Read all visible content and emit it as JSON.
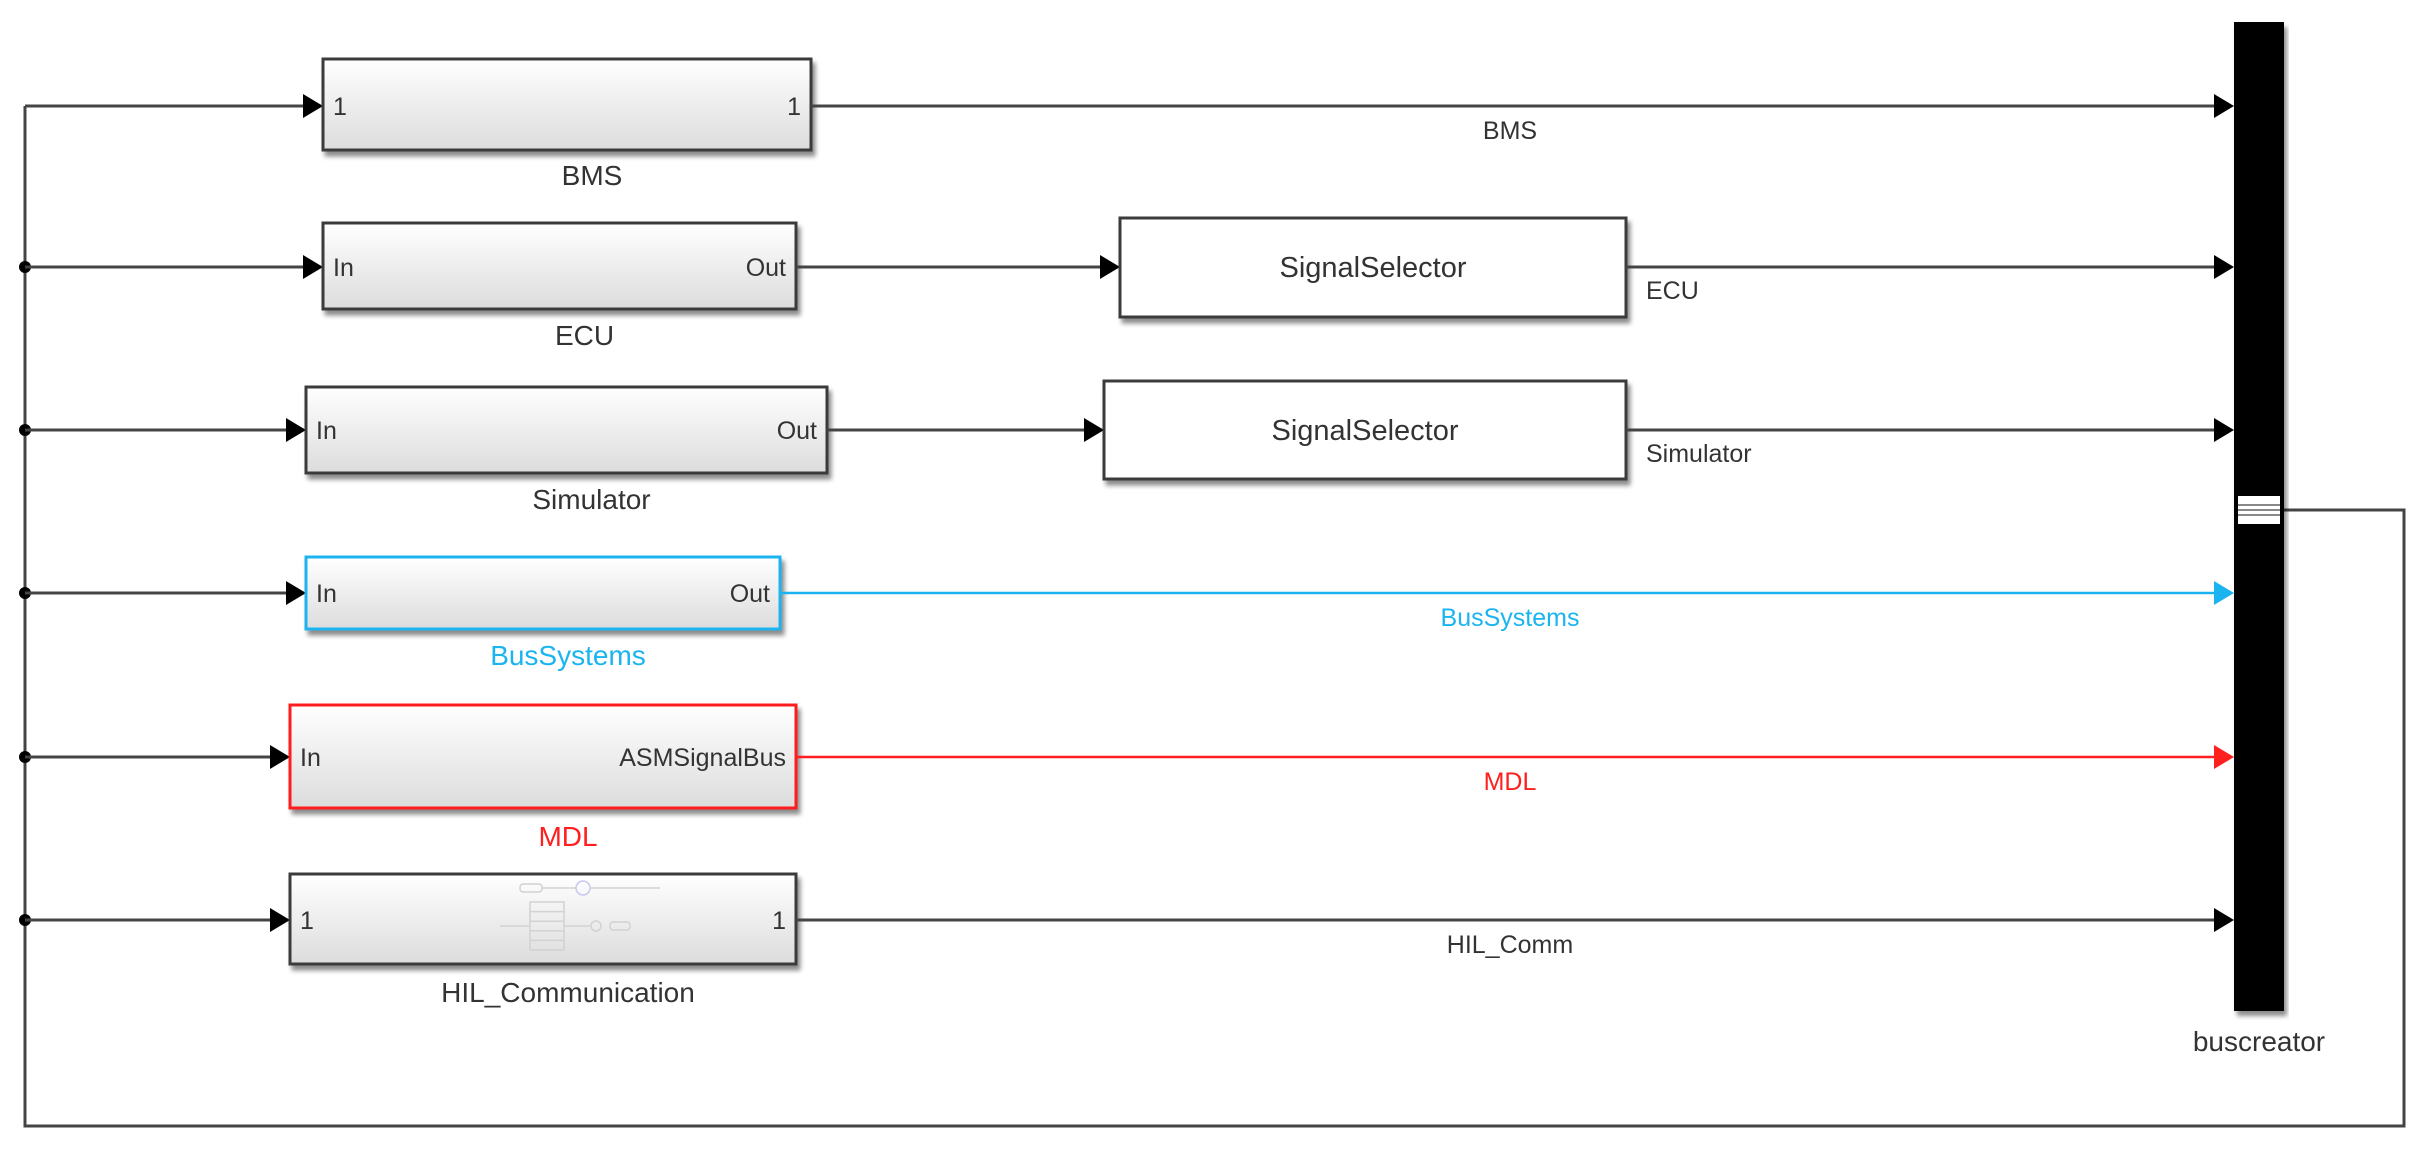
{
  "colors": {
    "line": "#444444",
    "arrow": "#000000",
    "bus_highlight": "#1ab4f0",
    "mdl_highlight": "#ff1f1f",
    "label": "#333333",
    "bus_creator": "#000000"
  },
  "subsystems": [
    {
      "id": "bms",
      "name": "BMS",
      "in_port": "1",
      "out_port": "1",
      "signal": "BMS",
      "highlight": null,
      "selector": null,
      "icon": null
    },
    {
      "id": "ecu",
      "name": "ECU",
      "in_port": "In",
      "out_port": "Out",
      "signal": "ECU",
      "highlight": null,
      "selector": "SignalSelector",
      "icon": null
    },
    {
      "id": "simulator",
      "name": "Simulator",
      "in_port": "In",
      "out_port": "Out",
      "signal": "Simulator",
      "highlight": null,
      "selector": "SignalSelector",
      "icon": null
    },
    {
      "id": "bussystems",
      "name": "BusSystems",
      "in_port": "In",
      "out_port": "Out",
      "signal": "BusSystems",
      "highlight": "bus_highlight",
      "selector": null,
      "icon": null
    },
    {
      "id": "mdl",
      "name": "MDL",
      "in_port": "In",
      "out_port": "ASMSignalBus",
      "signal": "MDL",
      "highlight": "mdl_highlight",
      "selector": null,
      "icon": null
    },
    {
      "id": "hil",
      "name": "HIL_Communication",
      "in_port": "1",
      "out_port": "1",
      "signal": "HIL_Comm",
      "highlight": null,
      "selector": null,
      "icon": "communication-icon"
    }
  ],
  "bus_creator": {
    "name": "buscreator",
    "input_count": 6
  }
}
